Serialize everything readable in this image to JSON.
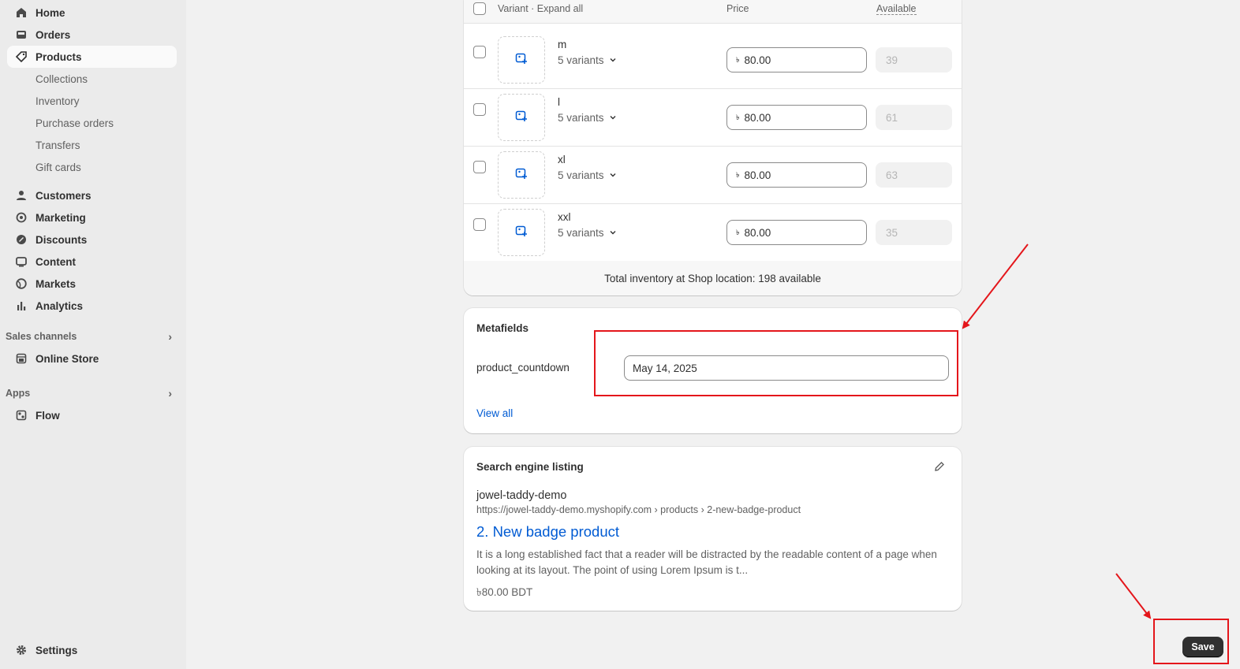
{
  "sidebar": {
    "items": [
      {
        "label": "Home",
        "icon": "home-icon"
      },
      {
        "label": "Orders",
        "icon": "inbox-icon"
      },
      {
        "label": "Products",
        "icon": "tag-icon"
      },
      {
        "label": "Customers",
        "icon": "person-icon"
      },
      {
        "label": "Marketing",
        "icon": "target-icon"
      },
      {
        "label": "Discounts",
        "icon": "discount-icon"
      },
      {
        "label": "Content",
        "icon": "content-icon"
      },
      {
        "label": "Markets",
        "icon": "globe-icon"
      },
      {
        "label": "Analytics",
        "icon": "bar-chart-icon"
      }
    ],
    "product_subitems": [
      "Collections",
      "Inventory",
      "Purchase orders",
      "Transfers",
      "Gift cards"
    ],
    "sales_channels_label": "Sales channels",
    "online_store_label": "Online Store",
    "apps_label": "Apps",
    "flow_label": "Flow",
    "settings_label": "Settings"
  },
  "variants": {
    "header": {
      "variant": "Variant",
      "expand_all": "Expand all",
      "price": "Price",
      "available": "Available"
    },
    "rows": [
      {
        "name": "m",
        "count": "5 variants",
        "currency": "৳",
        "price": "80.00",
        "available": "39"
      },
      {
        "name": "l",
        "count": "5 variants",
        "currency": "৳",
        "price": "80.00",
        "available": "61"
      },
      {
        "name": "xl",
        "count": "5 variants",
        "currency": "৳",
        "price": "80.00",
        "available": "63"
      },
      {
        "name": "xxl",
        "count": "5 variants",
        "currency": "৳",
        "price": "80.00",
        "available": "35"
      }
    ],
    "total": "Total inventory at Shop location: 198 available"
  },
  "metafields": {
    "title": "Metafields",
    "field_label": "product_countdown",
    "field_value": "May 14, 2025",
    "view_all": "View all"
  },
  "seo": {
    "title": "Search engine listing",
    "site_name": "jowel-taddy-demo",
    "url": "https://jowel-taddy-demo.myshopify.com › products › 2-new-badge-product",
    "page_title": "2. New badge product",
    "description": "It is a long established fact that a reader will be distracted by the readable content of a page when looking at its layout. The point of using Lorem Ipsum is t...",
    "price": "৳80.00 BDT"
  },
  "save_label": "Save",
  "colors": {
    "accent_link": "#005bd3",
    "annotation_red": "#e4161b",
    "primary_button": "#303030"
  }
}
